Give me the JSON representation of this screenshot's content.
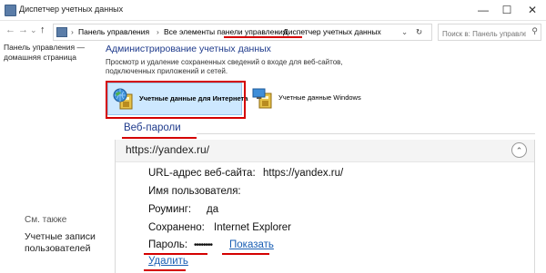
{
  "window": {
    "title": "Диспетчер учетных данных",
    "minimize_glyph": "—",
    "maximize_glyph": "☐",
    "close_glyph": "✕"
  },
  "address": {
    "back_glyph": "←",
    "forward_glyph": "→",
    "recent_glyph": "⌄",
    "up_glyph": "↑",
    "breadcrumbs": [
      "Панель управления",
      "Все элементы панели управления",
      "Диспетчер учетных данных"
    ],
    "separator": "›",
    "dropdown_glyph": "⌄",
    "refresh_glyph": "↻",
    "search_placeholder": "Поиск в: Панель управления",
    "search_icon": "search-icon"
  },
  "sidebar": {
    "home_link": "Панель управления — домашняя страница",
    "see_also": "См. также",
    "user_accounts_link": "Учетные записи пользователей"
  },
  "main": {
    "heading": "Администрирование учетных данных",
    "description": "Просмотр и удаление сохраненных сведений о входе для веб-сайтов, подключенных приложений и сетей.",
    "web_credentials_label": "Учетные данные для Интернета",
    "windows_credentials_label": "Учетные данные Windows",
    "section_title": "Веб-пароли",
    "entry": {
      "url": "https://yandex.ru/",
      "collapse_glyph": "⌃",
      "site_label": "URL-адрес веб-сайта:",
      "site_value": "https://yandex.ru/",
      "username_label": "Имя пользователя:",
      "roaming_label": "Роуминг:",
      "roaming_value": "да",
      "saved_label": "Сохранено:",
      "saved_value": "Internet Explorer",
      "password_label": "Пароль:",
      "password_value": "••••••••",
      "show_link": "Показать",
      "delete_link": "Удалить"
    }
  },
  "colors": {
    "accent_red": "#d40000",
    "link_blue": "#1a5fb4",
    "heading_blue": "#1f3b8c",
    "selection_bg": "#cde8ff"
  }
}
